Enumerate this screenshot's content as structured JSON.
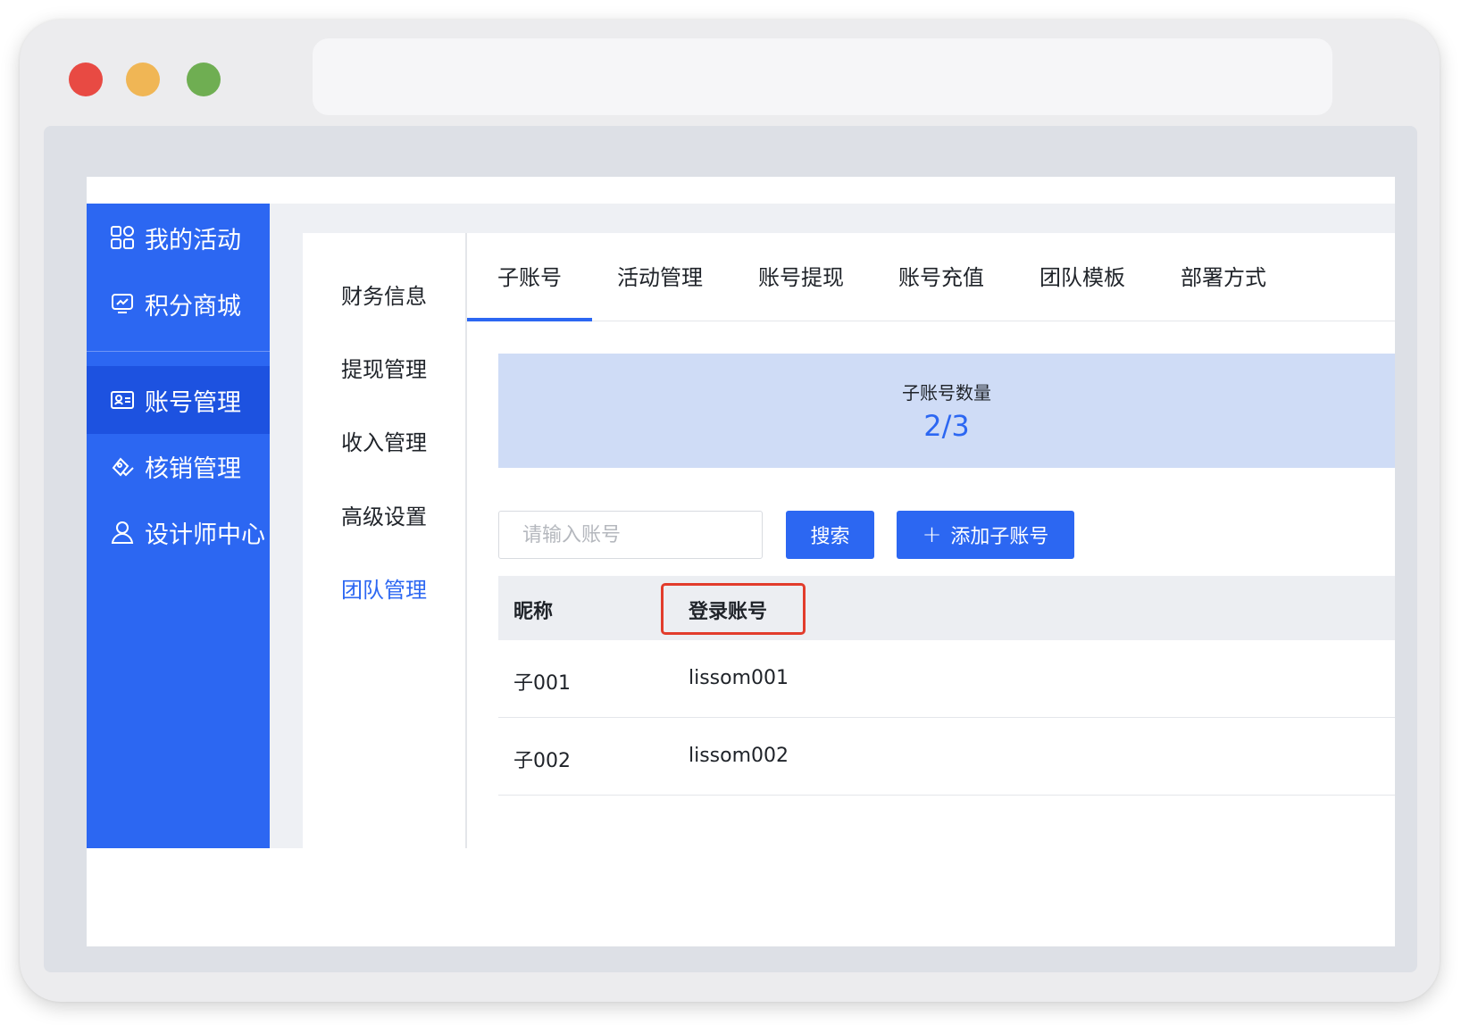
{
  "sidebar": {
    "items": [
      {
        "label": "我的活动",
        "icon": "grid-icon"
      },
      {
        "label": "积分商城",
        "icon": "chart-icon"
      },
      {
        "label": "账号管理",
        "icon": "id-card-icon",
        "active": true
      },
      {
        "label": "核销管理",
        "icon": "verify-icon"
      },
      {
        "label": "设计师中心",
        "icon": "user-icon"
      }
    ]
  },
  "submenu": {
    "items": [
      {
        "label": "财务信息"
      },
      {
        "label": "提现管理"
      },
      {
        "label": "收入管理"
      },
      {
        "label": "高级设置"
      },
      {
        "label": "团队管理",
        "active": true
      }
    ]
  },
  "tabs": [
    {
      "label": "子账号",
      "active": true
    },
    {
      "label": "活动管理"
    },
    {
      "label": "账号提现"
    },
    {
      "label": "账号充值"
    },
    {
      "label": "团队模板"
    },
    {
      "label": "部署方式"
    }
  ],
  "stats": {
    "label": "子账号数量",
    "value": "2/3"
  },
  "search": {
    "placeholder": "请输入账号",
    "value": "",
    "button_label": "搜索"
  },
  "add_button": {
    "label": "添加子账号"
  },
  "table": {
    "columns": [
      "昵称",
      "登录账号"
    ],
    "rows": [
      {
        "nickname": "子001",
        "account": "lissom001"
      },
      {
        "nickname": "子002",
        "account": "lissom002"
      }
    ]
  },
  "colors": {
    "primary": "#2c67f2",
    "sidebar_active": "#1d52e0",
    "highlight": "#e23c2c",
    "arrow": "#e8392c",
    "stat_bg": "#cfdcf6"
  }
}
